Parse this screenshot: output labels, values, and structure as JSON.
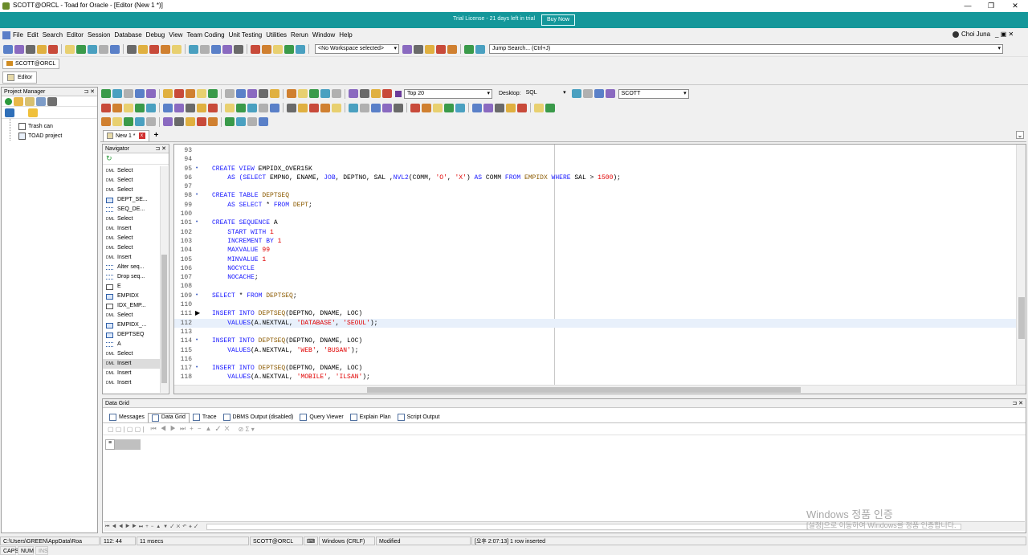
{
  "window": {
    "title": "SCOTT@ORCL - Toad for Oracle - [Editor (New 1 *)]"
  },
  "trial": {
    "text": "Trial License - 21 days left in trial",
    "buy_label": "Buy Now"
  },
  "menu": {
    "items": [
      "File",
      "Edit",
      "Search",
      "Editor",
      "Session",
      "Database",
      "Debug",
      "View",
      "Team Coding",
      "Unit Testing",
      "Utilities",
      "Rerun",
      "Window",
      "Help"
    ],
    "user": "Choi Juna"
  },
  "toolbar1": {
    "workspace": "<No Workspace selected>",
    "jump_search_placeholder": "Jump Search... (Ctrl+J)"
  },
  "connection_tab": "SCOTT@ORCL",
  "editor_tab": "Editor",
  "project_manager": {
    "title": "Project Manager",
    "items": [
      "Trash can",
      "TOAD project"
    ]
  },
  "editor_toolbar": {
    "top_label": "Top 20",
    "desktop_label": "Desktop:",
    "desktop_value": "SQL",
    "schema_value": "SCOTT"
  },
  "doc_tabs": {
    "active": "New 1 *",
    "add": "+"
  },
  "navigator": {
    "title": "Navigator",
    "items": [
      {
        "icon": "DML",
        "label": "Select"
      },
      {
        "icon": "DML",
        "label": "Select"
      },
      {
        "icon": "DML",
        "label": "Select"
      },
      {
        "icon": "TBL",
        "label": "DEPT_SE..."
      },
      {
        "icon": "SEQ",
        "label": "SEQ_DE..."
      },
      {
        "icon": "DML",
        "label": "Select"
      },
      {
        "icon": "DML",
        "label": "Insert"
      },
      {
        "icon": "DML",
        "label": "Select"
      },
      {
        "icon": "DML",
        "label": "Select"
      },
      {
        "icon": "DML",
        "label": "Insert"
      },
      {
        "icon": "SEQ",
        "label": "Alter seq..."
      },
      {
        "icon": "SEQ",
        "label": "Drop seq..."
      },
      {
        "icon": "IDX",
        "label": "E"
      },
      {
        "icon": "TBL",
        "label": "EMPIDX"
      },
      {
        "icon": "IDX",
        "label": "IDX_EMP..."
      },
      {
        "icon": "DML",
        "label": "Select"
      },
      {
        "icon": "TBL",
        "label": "EMPIDX_..."
      },
      {
        "icon": "TBL",
        "label": "DEPTSEQ"
      },
      {
        "icon": "SEQ",
        "label": "A"
      },
      {
        "icon": "DML",
        "label": "Select"
      },
      {
        "icon": "DML",
        "label": "Insert"
      },
      {
        "icon": "DML",
        "label": "Insert"
      },
      {
        "icon": "DML",
        "label": "Insert"
      }
    ]
  },
  "editor": {
    "lines": [
      {
        "n": "93",
        "dot": false,
        "segs": []
      },
      {
        "n": "94",
        "dot": false,
        "segs": []
      },
      {
        "n": "95",
        "dot": true,
        "segs": [
          [
            "kw",
            "CREATE VIEW "
          ],
          [
            "",
            "EMPIDX_OVER15K"
          ]
        ]
      },
      {
        "n": "96",
        "dot": false,
        "segs": [
          [
            "kw",
            "    AS ("
          ],
          [
            "kw",
            "SELECT "
          ],
          [
            "",
            "EMPNO, ENAME, "
          ],
          [
            "kw",
            "JOB"
          ],
          [
            "",
            ", DEPTNO, SAL ,"
          ],
          [
            "kw",
            "NVL2"
          ],
          [
            "",
            "(COMM, "
          ],
          [
            "str",
            "'O'"
          ],
          [
            "",
            ", "
          ],
          [
            "str",
            "'X'"
          ],
          [
            "",
            ") "
          ],
          [
            "kw",
            "AS "
          ],
          [
            "",
            "COMM "
          ],
          [
            "kw",
            "FROM "
          ],
          [
            "tbl",
            "EMPIDX "
          ],
          [
            "kw",
            "WHERE "
          ],
          [
            "",
            "SAL > "
          ],
          [
            "num",
            "1500"
          ],
          [
            "",
            ");"
          ]
        ]
      },
      {
        "n": "97",
        "dot": false,
        "segs": []
      },
      {
        "n": "98",
        "dot": true,
        "segs": [
          [
            "kw",
            "CREATE TABLE "
          ],
          [
            "tbl",
            "DEPTSEQ"
          ]
        ]
      },
      {
        "n": "99",
        "dot": false,
        "segs": [
          [
            "kw",
            "    AS SELECT "
          ],
          [
            "",
            "* "
          ],
          [
            "kw",
            "FROM "
          ],
          [
            "tbl",
            "DEPT"
          ],
          [
            "",
            ";"
          ]
        ]
      },
      {
        "n": "100",
        "dot": false,
        "segs": []
      },
      {
        "n": "101",
        "dot": true,
        "segs": [
          [
            "kw",
            "CREATE SEQUENCE "
          ],
          [
            "",
            "A"
          ]
        ]
      },
      {
        "n": "102",
        "dot": false,
        "segs": [
          [
            "kw",
            "    START WITH "
          ],
          [
            "num",
            "1"
          ]
        ]
      },
      {
        "n": "103",
        "dot": false,
        "segs": [
          [
            "kw",
            "    INCREMENT BY "
          ],
          [
            "num",
            "1"
          ]
        ]
      },
      {
        "n": "104",
        "dot": false,
        "segs": [
          [
            "kw",
            "    MAXVALUE "
          ],
          [
            "num",
            "99"
          ]
        ]
      },
      {
        "n": "105",
        "dot": false,
        "segs": [
          [
            "kw",
            "    MINVALUE "
          ],
          [
            "num",
            "1"
          ]
        ]
      },
      {
        "n": "106",
        "dot": false,
        "segs": [
          [
            "kw",
            "    NOCYCLE"
          ]
        ]
      },
      {
        "n": "107",
        "dot": false,
        "segs": [
          [
            "kw",
            "    NOCACHE"
          ],
          [
            "",
            ";"
          ]
        ]
      },
      {
        "n": "108",
        "dot": false,
        "segs": []
      },
      {
        "n": "109",
        "dot": true,
        "segs": [
          [
            "kw",
            "SELECT "
          ],
          [
            "",
            "* "
          ],
          [
            "kw",
            "FROM "
          ],
          [
            "tbl",
            "DEPTSEQ"
          ],
          [
            "",
            ";"
          ]
        ]
      },
      {
        "n": "110",
        "dot": false,
        "segs": []
      },
      {
        "n": "111",
        "dot": false,
        "arrow": true,
        "segs": [
          [
            "kw",
            "INSERT INTO "
          ],
          [
            "tbl",
            "DEPTSEQ"
          ],
          [
            "",
            "(DEPTNO, DNAME, LOC)"
          ]
        ]
      },
      {
        "n": "112",
        "dot": false,
        "current": true,
        "segs": [
          [
            "kw",
            "    VALUES"
          ],
          [
            "",
            "(A.NEXTVAL, "
          ],
          [
            "str",
            "'DATABASE'"
          ],
          [
            "",
            ", "
          ],
          [
            "str",
            "'SEOUL'"
          ],
          [
            "",
            ");"
          ]
        ]
      },
      {
        "n": "113",
        "dot": false,
        "segs": []
      },
      {
        "n": "114",
        "dot": true,
        "segs": [
          [
            "kw",
            "INSERT INTO "
          ],
          [
            "tbl",
            "DEPTSEQ"
          ],
          [
            "",
            "(DEPTNO, DNAME, LOC)"
          ]
        ]
      },
      {
        "n": "115",
        "dot": false,
        "segs": [
          [
            "kw",
            "    VALUES"
          ],
          [
            "",
            "(A.NEXTVAL, "
          ],
          [
            "str",
            "'WEB'"
          ],
          [
            "",
            ", "
          ],
          [
            "str",
            "'BUSAN'"
          ],
          [
            "",
            ");"
          ]
        ]
      },
      {
        "n": "116",
        "dot": false,
        "segs": []
      },
      {
        "n": "117",
        "dot": true,
        "segs": [
          [
            "kw",
            "INSERT INTO "
          ],
          [
            "tbl",
            "DEPTSEQ"
          ],
          [
            "",
            "(DEPTNO, DNAME, LOC)"
          ]
        ]
      },
      {
        "n": "118",
        "dot": false,
        "segs": [
          [
            "kw",
            "    VALUES"
          ],
          [
            "",
            "(A.NEXTVAL, "
          ],
          [
            "str",
            "'MOBILE'"
          ],
          [
            "",
            ", "
          ],
          [
            "str",
            "'ILSAN'"
          ],
          [
            "",
            ");"
          ]
        ]
      }
    ]
  },
  "data_grid": {
    "title": "Data Grid",
    "tabs": [
      "Messages",
      "Data Grid",
      "Trace",
      "DBMS Output (disabled)",
      "Query Viewer",
      "Explain Plan",
      "Script Output"
    ],
    "active_tab": "Data Grid"
  },
  "watermark": {
    "line1": "Windows 정품 인증",
    "line2": "[설정]으로 이동하여 Windows를 정품 인증합니다."
  },
  "status": {
    "path": "C:\\Users\\GREEN\\AppData\\Roa",
    "position": "112:  44",
    "elapsed": "11 msecs",
    "connection": "SCOTT@ORCL",
    "line_ending": "Windows (CRLF)",
    "modified": "Modified",
    "message": "[오후 2:07:13]   1 row inserted",
    "caps": "CAPS",
    "num": "NUM",
    "ins": "INS"
  },
  "colors": {
    "trial_bar": "#14979a",
    "keyword": "#1a1aff",
    "string": "#e00000",
    "table": "#8b5a00",
    "current_line": "#e8f0fb"
  }
}
